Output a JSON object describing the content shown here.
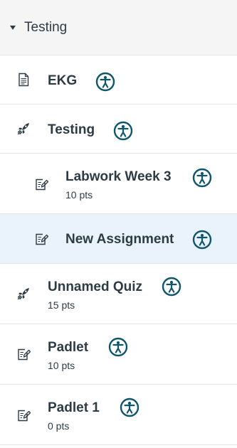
{
  "module": {
    "title": "Testing",
    "caret_icon": "caret-down-icon"
  },
  "items": [
    {
      "title": "EKG",
      "pts": "",
      "type_icon": "page-icon",
      "indent": false,
      "selected": false
    },
    {
      "title": "Testing",
      "pts": "",
      "type_icon": "quiz-rocket-icon",
      "indent": false,
      "selected": false
    },
    {
      "title": "Labwork Week 3",
      "pts": "10 pts",
      "type_icon": "assignment-icon",
      "indent": true,
      "selected": false
    },
    {
      "title": "New Assignment",
      "pts": "",
      "type_icon": "assignment-icon",
      "indent": true,
      "selected": true
    },
    {
      "title": "Unnamed Quiz",
      "pts": "15 pts",
      "type_icon": "quiz-rocket-icon",
      "indent": false,
      "selected": false
    },
    {
      "title": "Padlet",
      "pts": "10 pts",
      "type_icon": "assignment-icon",
      "indent": false,
      "selected": false
    },
    {
      "title": "Padlet 1",
      "pts": "0 pts",
      "type_icon": "assignment-icon",
      "indent": false,
      "selected": false
    }
  ],
  "accessibility_icon": "accessibility-icon",
  "colors": {
    "accessibility": "#0e566c",
    "selected_row": "#eaf3fb",
    "header_bg": "#f5f5f5",
    "text": "#2d3b45"
  }
}
